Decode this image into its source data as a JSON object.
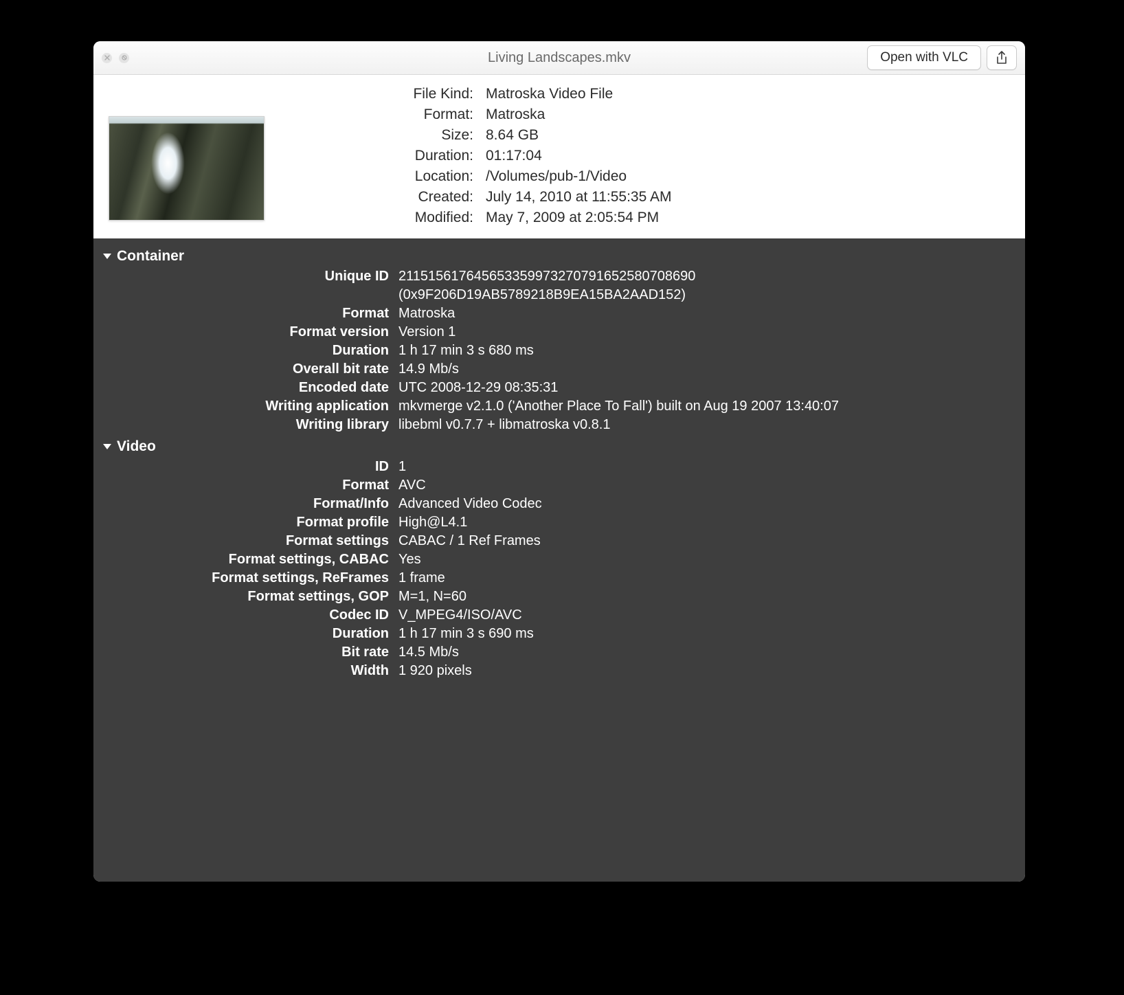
{
  "titlebar": {
    "title": "Living Landscapes.mkv",
    "open_button": "Open with VLC"
  },
  "info": {
    "file_kind_label": "File Kind:",
    "file_kind": "Matroska Video File",
    "format_label": "Format:",
    "format": "Matroska",
    "size_label": "Size:",
    "size": "8.64 GB",
    "duration_label": "Duration:",
    "duration": "01:17:04",
    "location_label": "Location:",
    "location": "/Volumes/pub-1/Video",
    "created_label": "Created:",
    "created": "July 14, 2010 at 11:55:35 AM",
    "modified_label": "Modified:",
    "modified": "May 7, 2009 at 2:05:54 PM"
  },
  "container": {
    "heading": "Container",
    "unique_id_label": "Unique ID",
    "unique_id_line1": "211515617645653359973270791652580708690",
    "unique_id_line2": "(0x9F206D19AB5789218B9EA15BA2AAD152)",
    "format_label": "Format",
    "format": "Matroska",
    "format_version_label": "Format version",
    "format_version": "Version 1",
    "duration_label": "Duration",
    "duration": "1 h 17 min 3 s 680 ms",
    "overall_bit_rate_label": "Overall bit rate",
    "overall_bit_rate": "14.9 Mb/s",
    "encoded_date_label": "Encoded date",
    "encoded_date": "UTC 2008-12-29 08:35:31",
    "writing_application_label": "Writing application",
    "writing_application": "mkvmerge v2.1.0 ('Another Place To Fall') built on Aug 19 2007 13:40:07",
    "writing_library_label": "Writing library",
    "writing_library": "libebml v0.7.7 + libmatroska v0.8.1"
  },
  "video": {
    "heading": "Video",
    "id_label": "ID",
    "id": "1",
    "format_label": "Format",
    "format": "AVC",
    "format_info_label": "Format/Info",
    "format_info": "Advanced Video Codec",
    "format_profile_label": "Format profile",
    "format_profile": "High@L4.1",
    "format_settings_label": "Format settings",
    "format_settings": "CABAC / 1 Ref Frames",
    "format_settings_cabac_label": "Format settings, CABAC",
    "format_settings_cabac": "Yes",
    "format_settings_reframes_label": "Format settings, ReFrames",
    "format_settings_reframes": "1 frame",
    "format_settings_gop_label": "Format settings, GOP",
    "format_settings_gop": "M=1, N=60",
    "codec_id_label": "Codec ID",
    "codec_id": "V_MPEG4/ISO/AVC",
    "duration_label": "Duration",
    "duration": "1 h 17 min 3 s 690 ms",
    "bit_rate_label": "Bit rate",
    "bit_rate": "14.5 Mb/s",
    "width_label": "Width",
    "width": "1 920 pixels"
  }
}
